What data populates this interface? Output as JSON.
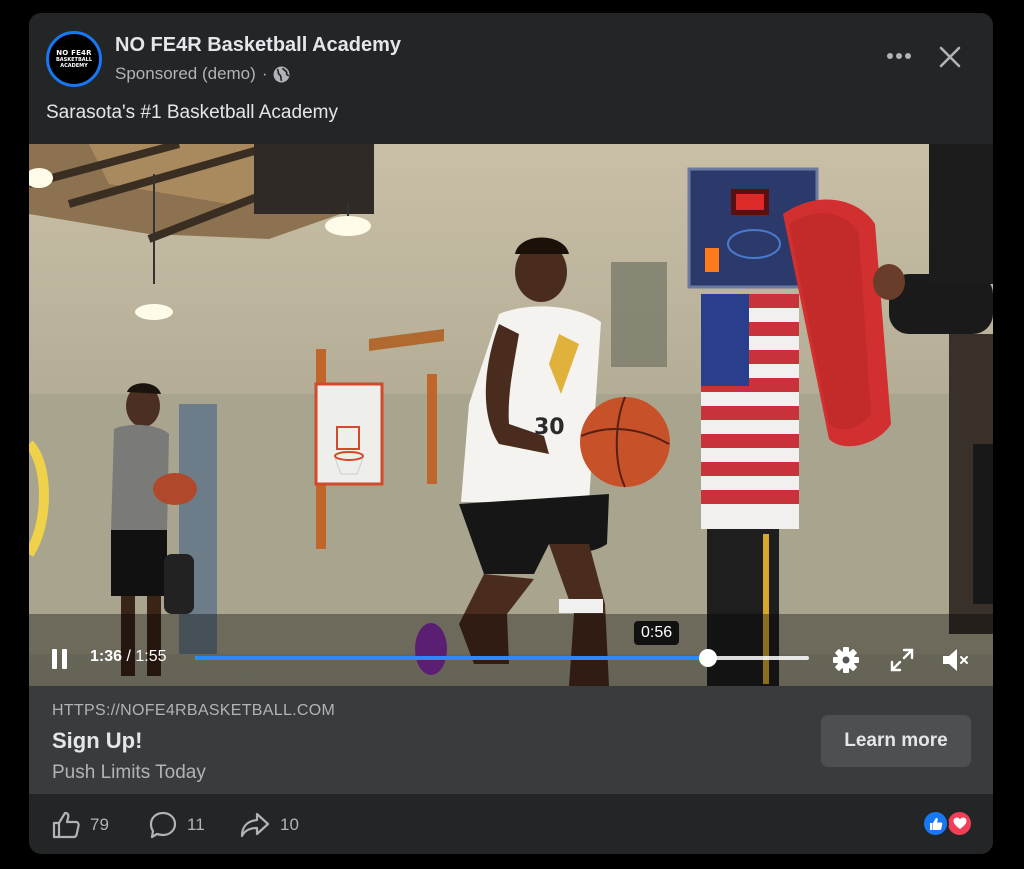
{
  "post": {
    "avatar_text": [
      "NO FE4R",
      "BASKETBALL",
      "ACADEMY"
    ],
    "page_name": "NO FE4R Basketball Academy",
    "sponsored": "Sponsored (demo)",
    "separator": "·",
    "audience_icon": "globe-icon",
    "more_icon": "ellipsis-icon",
    "close_icon": "close-icon",
    "caption": "Sarasota's #1 Basketball Academy"
  },
  "video": {
    "current_time": "1:36",
    "separator": "/",
    "duration": "1:55",
    "progress_fraction": 0.835,
    "hover_time": "0:56",
    "hover_fraction": 0.5,
    "icons": [
      "pause-icon",
      "settings-icon",
      "fullscreen-icon",
      "mute-icon"
    ]
  },
  "link": {
    "url": "HTTPS://NOFE4RBASKETBALL.COM",
    "title": "Sign Up!",
    "description": "Push Limits Today",
    "cta": "Learn more"
  },
  "engagement": {
    "likes": "79",
    "comments": "11",
    "shares": "10",
    "reaction_icons": [
      "like-reaction-icon",
      "love-reaction-icon"
    ]
  },
  "colors": {
    "card_bg": "#242526",
    "link_bg": "#3a3b3c",
    "accent_blue": "#1877f2",
    "progress_blue": "#2d88ff",
    "love_red": "#f33e58"
  }
}
